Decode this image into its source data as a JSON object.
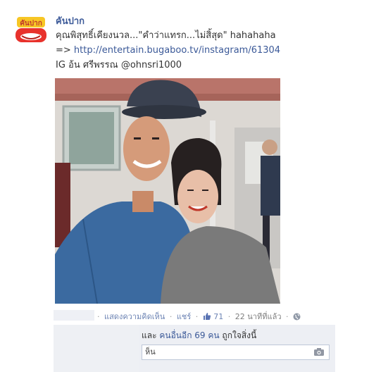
{
  "post": {
    "page_name": "คันปาก",
    "avatar_text": "คันปาก",
    "line1": "คุณพิสุทธิ์เคียงนวล...\"คำว่าแทรก...ไม่สิ้สุด\" hahahaha",
    "line2_prefix": "=> ",
    "link": "http://entertain.bugaboo.tv/instagram/61304",
    "line3": "IG อ้น ศรีพรรณ @ohnsri1000"
  },
  "actions": {
    "comment": "แสดงความคิดเห็น",
    "share": "แชร์",
    "like_count": "71",
    "time": "22 นาทีที่แล้ว",
    "separator": "·"
  },
  "likes": {
    "prefix": "และ ",
    "others_link": "คนอื่นอีก 69 คน",
    "suffix": " ถูกใจสิ่งนี้"
  },
  "comment_box": {
    "value": "ห็น"
  },
  "icons": {
    "like": "thumbs-up-icon",
    "privacy": "globe-icon",
    "camera": "camera-icon"
  },
  "colors": {
    "link": "#3b5998",
    "action_link": "#6d84b4",
    "likes_bg": "#edeff4"
  }
}
